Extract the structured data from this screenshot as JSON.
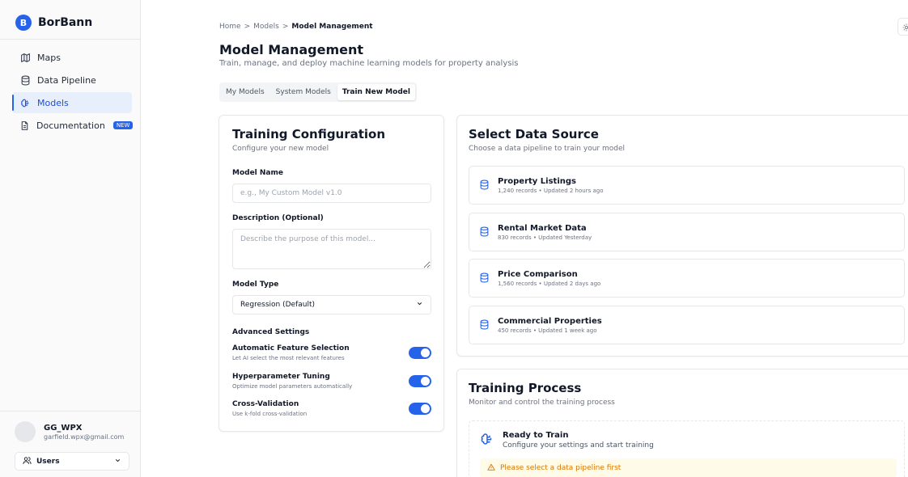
{
  "brand": {
    "logo_letter": "B",
    "name": "BorBann"
  },
  "nav": {
    "items": [
      {
        "label": "Maps",
        "icon": "map-icon"
      },
      {
        "label": "Data Pipeline",
        "icon": "database-icon"
      },
      {
        "label": "Models",
        "icon": "brain-icon",
        "active": true
      },
      {
        "label": "Documentation",
        "icon": "document-icon",
        "badge": "NEW"
      }
    ]
  },
  "user": {
    "name": "GG_WPX",
    "email": "garfield.wpx@gmail.com",
    "role_select": "Users"
  },
  "breadcrumb": {
    "home": "Home",
    "sep1": ">",
    "models": "Models",
    "sep2": ">",
    "current": "Model Management"
  },
  "header": {
    "title": "Model Management",
    "subtitle": "Train, manage, and deploy machine learning models for property analysis"
  },
  "tabs": [
    {
      "label": "My Models"
    },
    {
      "label": "System Models"
    },
    {
      "label": "Train New Model",
      "active": true
    }
  ],
  "config": {
    "title": "Training Configuration",
    "subtitle": "Configure your new model",
    "model_name_label": "Model Name",
    "model_name_placeholder": "e.g., My Custom Model v1.0",
    "model_name_value": "",
    "description_label": "Description (Optional)",
    "description_placeholder": "Describe the purpose of this model...",
    "model_type_label": "Model Type",
    "model_type_value": "Regression (Default)",
    "advanced_label": "Advanced Settings",
    "settings": [
      {
        "title": "Automatic Feature Selection",
        "desc": "Let AI select the most relevant features",
        "enabled": true
      },
      {
        "title": "Hyperparameter Tuning",
        "desc": "Optimize model parameters automatically",
        "enabled": true
      },
      {
        "title": "Cross-Validation",
        "desc": "Use k-fold cross-validation",
        "enabled": true
      }
    ]
  },
  "datasource": {
    "title": "Select Data Source",
    "subtitle": "Choose a data pipeline to train your model",
    "items": [
      {
        "name": "Property Listings",
        "meta": "1,240 records • Updated 2 hours ago"
      },
      {
        "name": "Rental Market Data",
        "meta": "830 records • Updated Yesterday"
      },
      {
        "name": "Price Comparison",
        "meta": "1,560 records • Updated 2 days ago"
      },
      {
        "name": "Commercial Properties",
        "meta": "450 records • Updated 1 week ago"
      }
    ]
  },
  "training": {
    "title": "Training Process",
    "subtitle": "Monitor and control the training process",
    "ready_title": "Ready to Train",
    "ready_sub": "Configure your settings and start training",
    "warning": "Please select a data pipeline first"
  },
  "colors": {
    "accent": "#2563eb",
    "warning": "#d97706",
    "warning_bg": "#fefce8"
  }
}
